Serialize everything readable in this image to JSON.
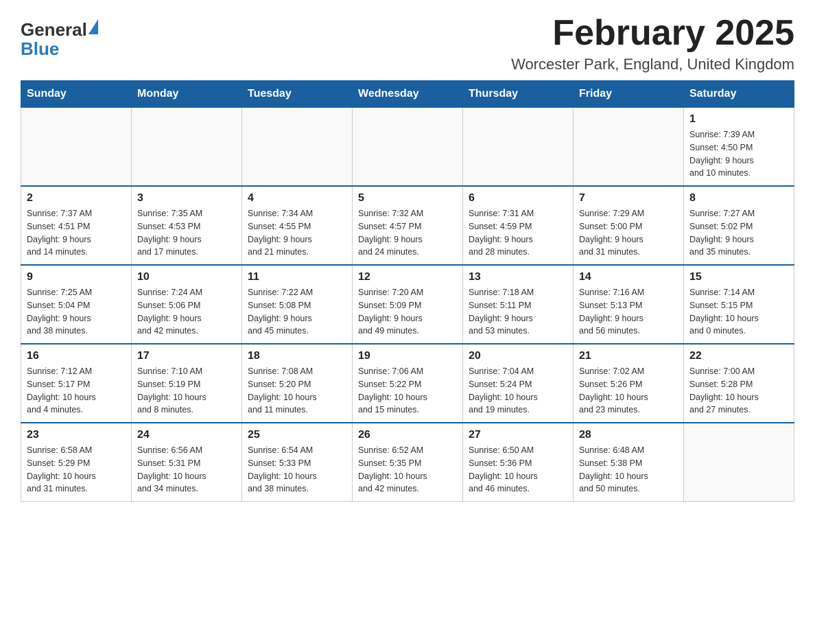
{
  "logo": {
    "text1": "General",
    "text2": "Blue"
  },
  "title": "February 2025",
  "subtitle": "Worcester Park, England, United Kingdom",
  "headers": [
    "Sunday",
    "Monday",
    "Tuesday",
    "Wednesday",
    "Thursday",
    "Friday",
    "Saturday"
  ],
  "weeks": [
    [
      {
        "day": "",
        "info": ""
      },
      {
        "day": "",
        "info": ""
      },
      {
        "day": "",
        "info": ""
      },
      {
        "day": "",
        "info": ""
      },
      {
        "day": "",
        "info": ""
      },
      {
        "day": "",
        "info": ""
      },
      {
        "day": "1",
        "info": "Sunrise: 7:39 AM\nSunset: 4:50 PM\nDaylight: 9 hours\nand 10 minutes."
      }
    ],
    [
      {
        "day": "2",
        "info": "Sunrise: 7:37 AM\nSunset: 4:51 PM\nDaylight: 9 hours\nand 14 minutes."
      },
      {
        "day": "3",
        "info": "Sunrise: 7:35 AM\nSunset: 4:53 PM\nDaylight: 9 hours\nand 17 minutes."
      },
      {
        "day": "4",
        "info": "Sunrise: 7:34 AM\nSunset: 4:55 PM\nDaylight: 9 hours\nand 21 minutes."
      },
      {
        "day": "5",
        "info": "Sunrise: 7:32 AM\nSunset: 4:57 PM\nDaylight: 9 hours\nand 24 minutes."
      },
      {
        "day": "6",
        "info": "Sunrise: 7:31 AM\nSunset: 4:59 PM\nDaylight: 9 hours\nand 28 minutes."
      },
      {
        "day": "7",
        "info": "Sunrise: 7:29 AM\nSunset: 5:00 PM\nDaylight: 9 hours\nand 31 minutes."
      },
      {
        "day": "8",
        "info": "Sunrise: 7:27 AM\nSunset: 5:02 PM\nDaylight: 9 hours\nand 35 minutes."
      }
    ],
    [
      {
        "day": "9",
        "info": "Sunrise: 7:25 AM\nSunset: 5:04 PM\nDaylight: 9 hours\nand 38 minutes."
      },
      {
        "day": "10",
        "info": "Sunrise: 7:24 AM\nSunset: 5:06 PM\nDaylight: 9 hours\nand 42 minutes."
      },
      {
        "day": "11",
        "info": "Sunrise: 7:22 AM\nSunset: 5:08 PM\nDaylight: 9 hours\nand 45 minutes."
      },
      {
        "day": "12",
        "info": "Sunrise: 7:20 AM\nSunset: 5:09 PM\nDaylight: 9 hours\nand 49 minutes."
      },
      {
        "day": "13",
        "info": "Sunrise: 7:18 AM\nSunset: 5:11 PM\nDaylight: 9 hours\nand 53 minutes."
      },
      {
        "day": "14",
        "info": "Sunrise: 7:16 AM\nSunset: 5:13 PM\nDaylight: 9 hours\nand 56 minutes."
      },
      {
        "day": "15",
        "info": "Sunrise: 7:14 AM\nSunset: 5:15 PM\nDaylight: 10 hours\nand 0 minutes."
      }
    ],
    [
      {
        "day": "16",
        "info": "Sunrise: 7:12 AM\nSunset: 5:17 PM\nDaylight: 10 hours\nand 4 minutes."
      },
      {
        "day": "17",
        "info": "Sunrise: 7:10 AM\nSunset: 5:19 PM\nDaylight: 10 hours\nand 8 minutes."
      },
      {
        "day": "18",
        "info": "Sunrise: 7:08 AM\nSunset: 5:20 PM\nDaylight: 10 hours\nand 11 minutes."
      },
      {
        "day": "19",
        "info": "Sunrise: 7:06 AM\nSunset: 5:22 PM\nDaylight: 10 hours\nand 15 minutes."
      },
      {
        "day": "20",
        "info": "Sunrise: 7:04 AM\nSunset: 5:24 PM\nDaylight: 10 hours\nand 19 minutes."
      },
      {
        "day": "21",
        "info": "Sunrise: 7:02 AM\nSunset: 5:26 PM\nDaylight: 10 hours\nand 23 minutes."
      },
      {
        "day": "22",
        "info": "Sunrise: 7:00 AM\nSunset: 5:28 PM\nDaylight: 10 hours\nand 27 minutes."
      }
    ],
    [
      {
        "day": "23",
        "info": "Sunrise: 6:58 AM\nSunset: 5:29 PM\nDaylight: 10 hours\nand 31 minutes."
      },
      {
        "day": "24",
        "info": "Sunrise: 6:56 AM\nSunset: 5:31 PM\nDaylight: 10 hours\nand 34 minutes."
      },
      {
        "day": "25",
        "info": "Sunrise: 6:54 AM\nSunset: 5:33 PM\nDaylight: 10 hours\nand 38 minutes."
      },
      {
        "day": "26",
        "info": "Sunrise: 6:52 AM\nSunset: 5:35 PM\nDaylight: 10 hours\nand 42 minutes."
      },
      {
        "day": "27",
        "info": "Sunrise: 6:50 AM\nSunset: 5:36 PM\nDaylight: 10 hours\nand 46 minutes."
      },
      {
        "day": "28",
        "info": "Sunrise: 6:48 AM\nSunset: 5:38 PM\nDaylight: 10 hours\nand 50 minutes."
      },
      {
        "day": "",
        "info": ""
      }
    ]
  ]
}
